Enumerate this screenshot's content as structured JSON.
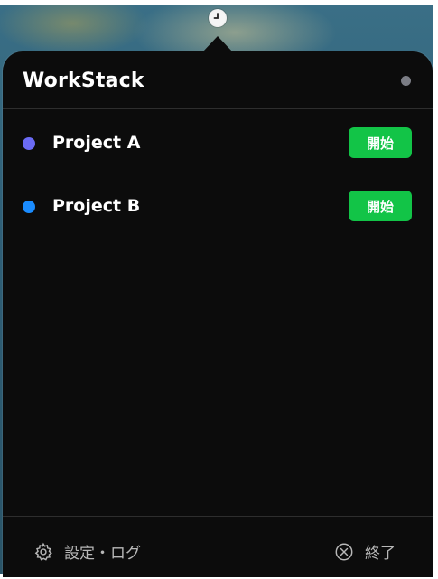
{
  "app": {
    "title": "WorkStack"
  },
  "projects": [
    {
      "name": "Project A",
      "color": "#6b6bf5",
      "action_label": "開始"
    },
    {
      "name": "Project B",
      "color": "#1a8cff",
      "action_label": "開始"
    }
  ],
  "footer": {
    "settings_label": "設定・ログ",
    "quit_label": "終了"
  },
  "icons": {
    "menubar": "clock-icon",
    "settings": "gear-icon",
    "quit": "close-circle-icon"
  },
  "colors": {
    "start_button": "#12c447",
    "status_dot": "#7b7d85"
  }
}
